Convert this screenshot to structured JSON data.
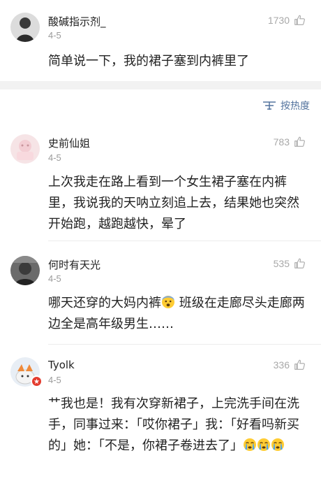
{
  "sort": {
    "label": "按热度",
    "icon": "sort-lines-icon"
  },
  "comments": [
    {
      "user": "酸碱指示剂_",
      "date": "4-5",
      "likes": "1730",
      "text": "简单说一下，我的裙子塞到内裤里了"
    },
    {
      "user": "史前仙姐",
      "date": "4-5",
      "likes": "783",
      "text": "上次我走在路上看到一个女生裙子塞在内裤里，我说我的天呐立刻追上去，结果她也突然开始跑，越跑越快，晕了"
    },
    {
      "user": "何时有天光",
      "date": "4-5",
      "likes": "535",
      "text_a": "哪天还穿的大妈内裤",
      "text_b": " 班级在走廊尽头走廊两边全是高年级男生……"
    },
    {
      "user": "Tyolk",
      "date": "4-5",
      "likes": "336",
      "text_a": "艹我也是！我有次穿新裙子，上完洗手间在洗手，同事过来：「哎你裙子」我：「好看吗新买的」她：「不是，你裙子卷进去了」"
    }
  ],
  "colors": {
    "accent": "#53739e",
    "meta": "#9a9a9a",
    "divider": "#ececec"
  }
}
